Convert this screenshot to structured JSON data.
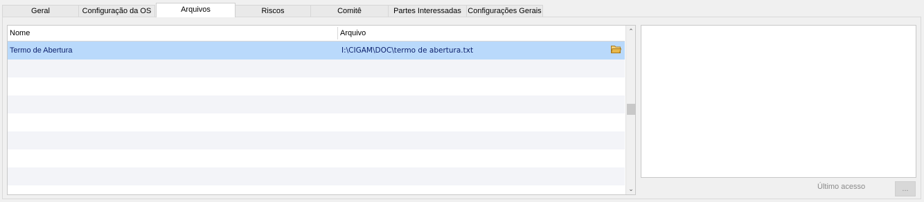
{
  "tabs": [
    {
      "label": "Geral",
      "active": false
    },
    {
      "label": "Configuração da OS",
      "active": false
    },
    {
      "label": "Arquivos",
      "active": true
    },
    {
      "label": "Riscos",
      "active": false
    },
    {
      "label": "Comitê",
      "active": false
    },
    {
      "label": "Partes Interessadas",
      "active": false
    },
    {
      "label": "Configurações Gerais",
      "active": false
    }
  ],
  "grid": {
    "columns": [
      "Nome",
      "Arquivo"
    ],
    "rows": [
      {
        "nome": "Termo de Abertura",
        "arquivo": "I:\\CIGAM\\DOC\\termo de abertura.txt",
        "selected": true
      }
    ],
    "empty_rows": 7
  },
  "icons": {
    "folder": "folder-open-icon",
    "scroll_up": "chevron-up-icon",
    "scroll_down": "chevron-down-icon"
  },
  "colors": {
    "selected_row": "#b9d9fb",
    "alt_row": "#f3f4f8",
    "text_blue": "#0b1f6b",
    "folder": "#e8b84a"
  },
  "footer": {
    "last_access_label": "Último acesso",
    "dots_button": "..."
  }
}
